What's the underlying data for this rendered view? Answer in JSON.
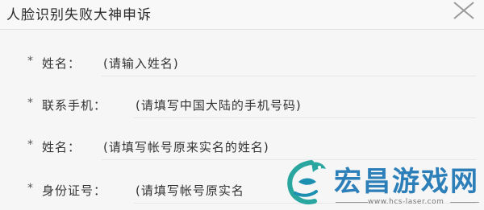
{
  "dialog": {
    "title": "人脸识别失败大神申诉",
    "close_icon": "close-icon"
  },
  "form": {
    "required_mark": "*",
    "fields": [
      {
        "label": "姓名：",
        "placeholder": "(请输入姓名)"
      },
      {
        "label": "联系手机：",
        "placeholder": "(请填写中国大陆的手机号码)"
      },
      {
        "label": "姓名：",
        "placeholder": "(请填写帐号原来实名的姓名)"
      },
      {
        "label": "身份证号：",
        "placeholder": "(请填写帐号原实名"
      }
    ]
  },
  "watermark": {
    "name": "宏昌游戏网",
    "url": "www.hcs-laser.com",
    "color": "#2c7fb8"
  }
}
